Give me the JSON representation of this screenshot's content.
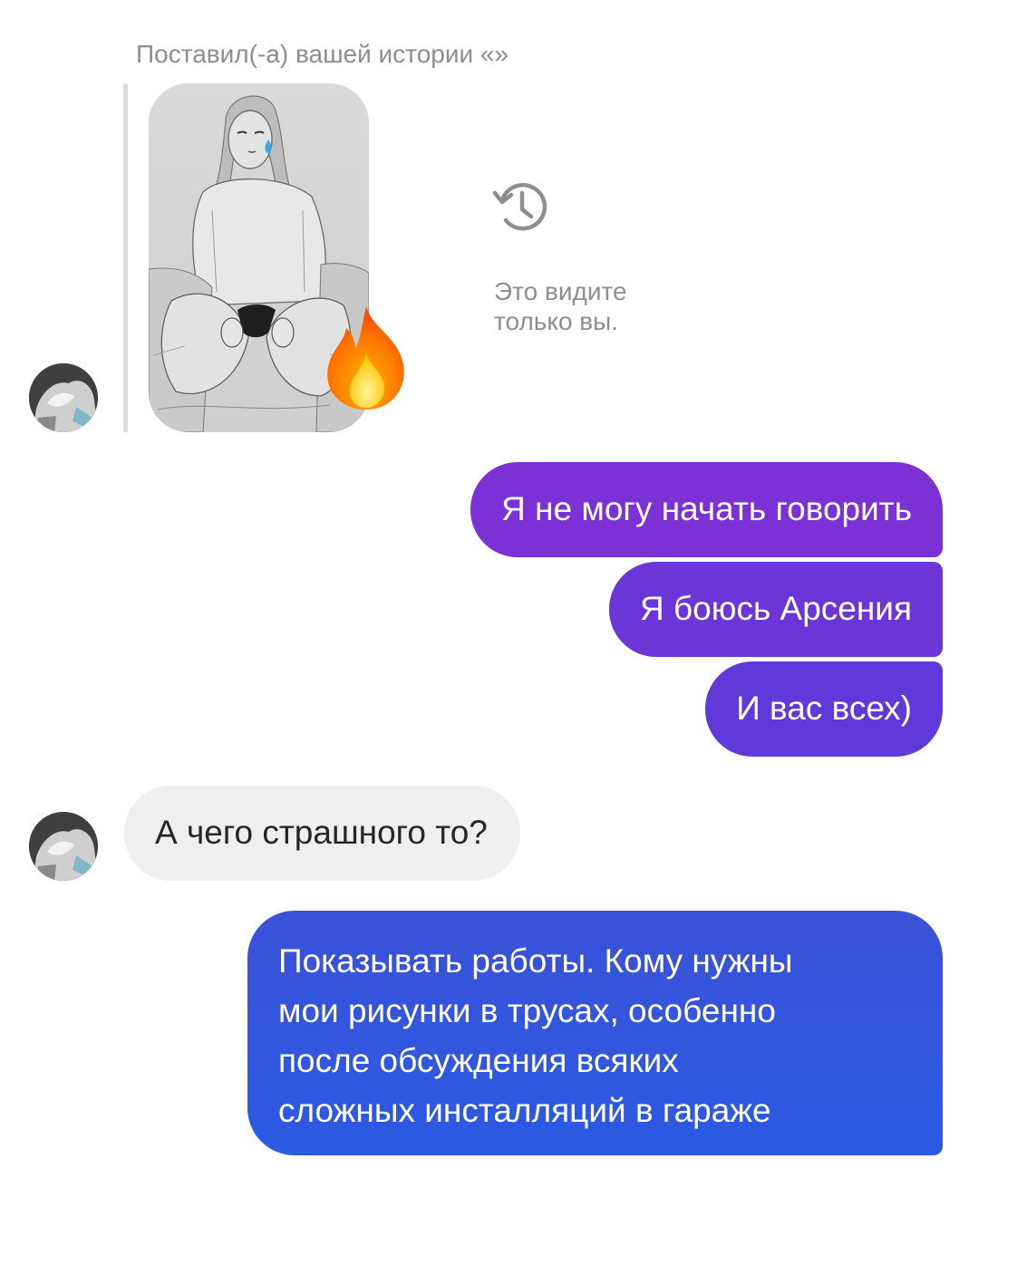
{
  "story_reply": {
    "caption": "Поставил(-а) вашей истории «»",
    "reaction_emoji": "fire-emoji",
    "thumbnail": "pencil-sketch-of-woman-with-blue-tear",
    "expired_notice": "Это видите только вы."
  },
  "messages": [
    {
      "id": "m1",
      "direction": "outgoing",
      "text": "Я не могу начать говорить"
    },
    {
      "id": "m2",
      "direction": "outgoing",
      "text": "Я боюсь Арсения"
    },
    {
      "id": "m3",
      "direction": "outgoing",
      "text": "И вас всех)"
    },
    {
      "id": "m4",
      "direction": "incoming",
      "text": "А чего страшного то?"
    },
    {
      "id": "m5",
      "direction": "outgoing",
      "lines": [
        "Показывать работы. Кому нужны",
        "мои рисунки в трусах, особенно",
        "после обсуждения всяких",
        "сложных инсталляций в гараже"
      ]
    }
  ],
  "colors": {
    "outgoing_purple_top": "#7b31d6",
    "outgoing_purple_mid": "#6c35d8",
    "outgoing_purple_low": "#5f39da",
    "outgoing_blue": "#3454dd",
    "incoming_gray": "#efefef",
    "muted_text": "#8e8e8e"
  }
}
